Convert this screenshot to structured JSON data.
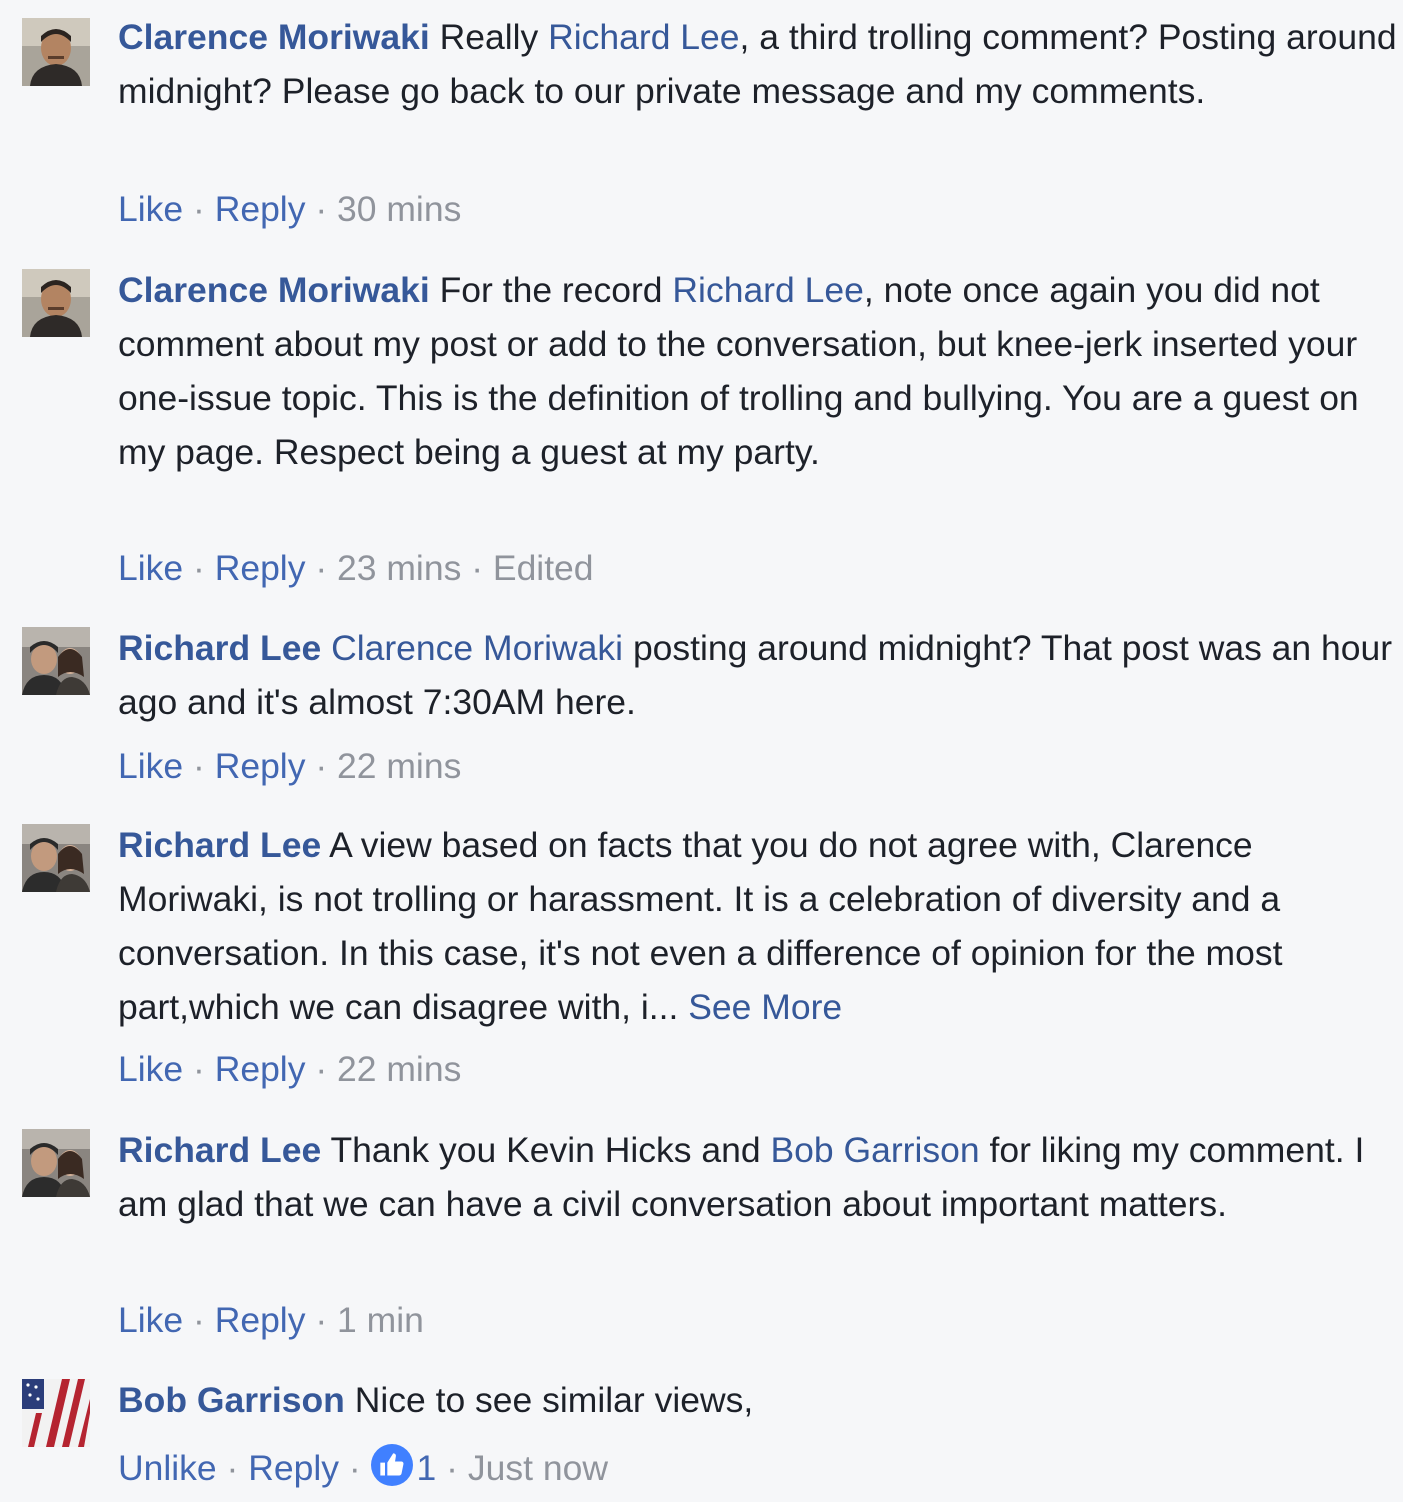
{
  "colors": {
    "link": "#365899",
    "action": "#4267b2",
    "meta": "#90949c",
    "text": "#1d2129",
    "background": "#f6f7f9",
    "like_badge": "#4080ff"
  },
  "comments": [
    {
      "avatar": "clarence-avatar",
      "author": "Clarence Moriwaki",
      "t1": " Really ",
      "mention1": "Richard Lee",
      "t2": ", a third trolling comment? Posting around midnight? Please go back to our private message and my comments.",
      "actions": {
        "like": "Like",
        "reply": "Reply",
        "time": "30 mins"
      }
    },
    {
      "avatar": "clarence-avatar",
      "author": "Clarence Moriwaki",
      "t1": " For the record ",
      "mention1": "Richard Lee",
      "t2": ", note once again you did not comment about my post or add to the conversation, but knee-jerk inserted your one-issue topic. This is the definition of trolling and bullying. You are a guest on my page. Respect being a guest at my party.",
      "actions": {
        "like": "Like",
        "reply": "Reply",
        "time": "23 mins",
        "edited": "Edited"
      }
    },
    {
      "avatar": "richard-avatar",
      "author": "Richard Lee",
      "t1": " ",
      "mention1": "Clarence Moriwaki",
      "t2": " posting around midnight? That post was an hour ago and it's almost 7:30AM here.",
      "actions": {
        "like": "Like",
        "reply": "Reply",
        "time": "22 mins"
      }
    },
    {
      "avatar": "richard-avatar",
      "author": "Richard Lee",
      "t1": " A view based on facts that you do not agree with, Clarence Moriwaki, is not trolling or harassment. It is a celebration of diversity and a conversation. In this case, it's not even a difference of opinion for the most part,which we can disagree with, i... ",
      "see_more": "See More",
      "actions": {
        "like": "Like",
        "reply": "Reply",
        "time": "22 mins"
      }
    },
    {
      "avatar": "richard-avatar",
      "author": "Richard Lee",
      "t1": " Thank you Kevin Hicks and ",
      "mention1": "Bob Garrison",
      "t2": " for liking my comment. I am glad that we can have a civil conversation about important matters.",
      "actions": {
        "like": "Like",
        "reply": "Reply",
        "time": "1 min"
      }
    },
    {
      "avatar": "bob-avatar",
      "author": "Bob Garrison",
      "t1": " Nice to see similar views,",
      "actions": {
        "like": "Unlike",
        "reply": "Reply",
        "like_icon": "thumbs-up-icon",
        "like_count": "1",
        "time": "Just now"
      }
    }
  ]
}
